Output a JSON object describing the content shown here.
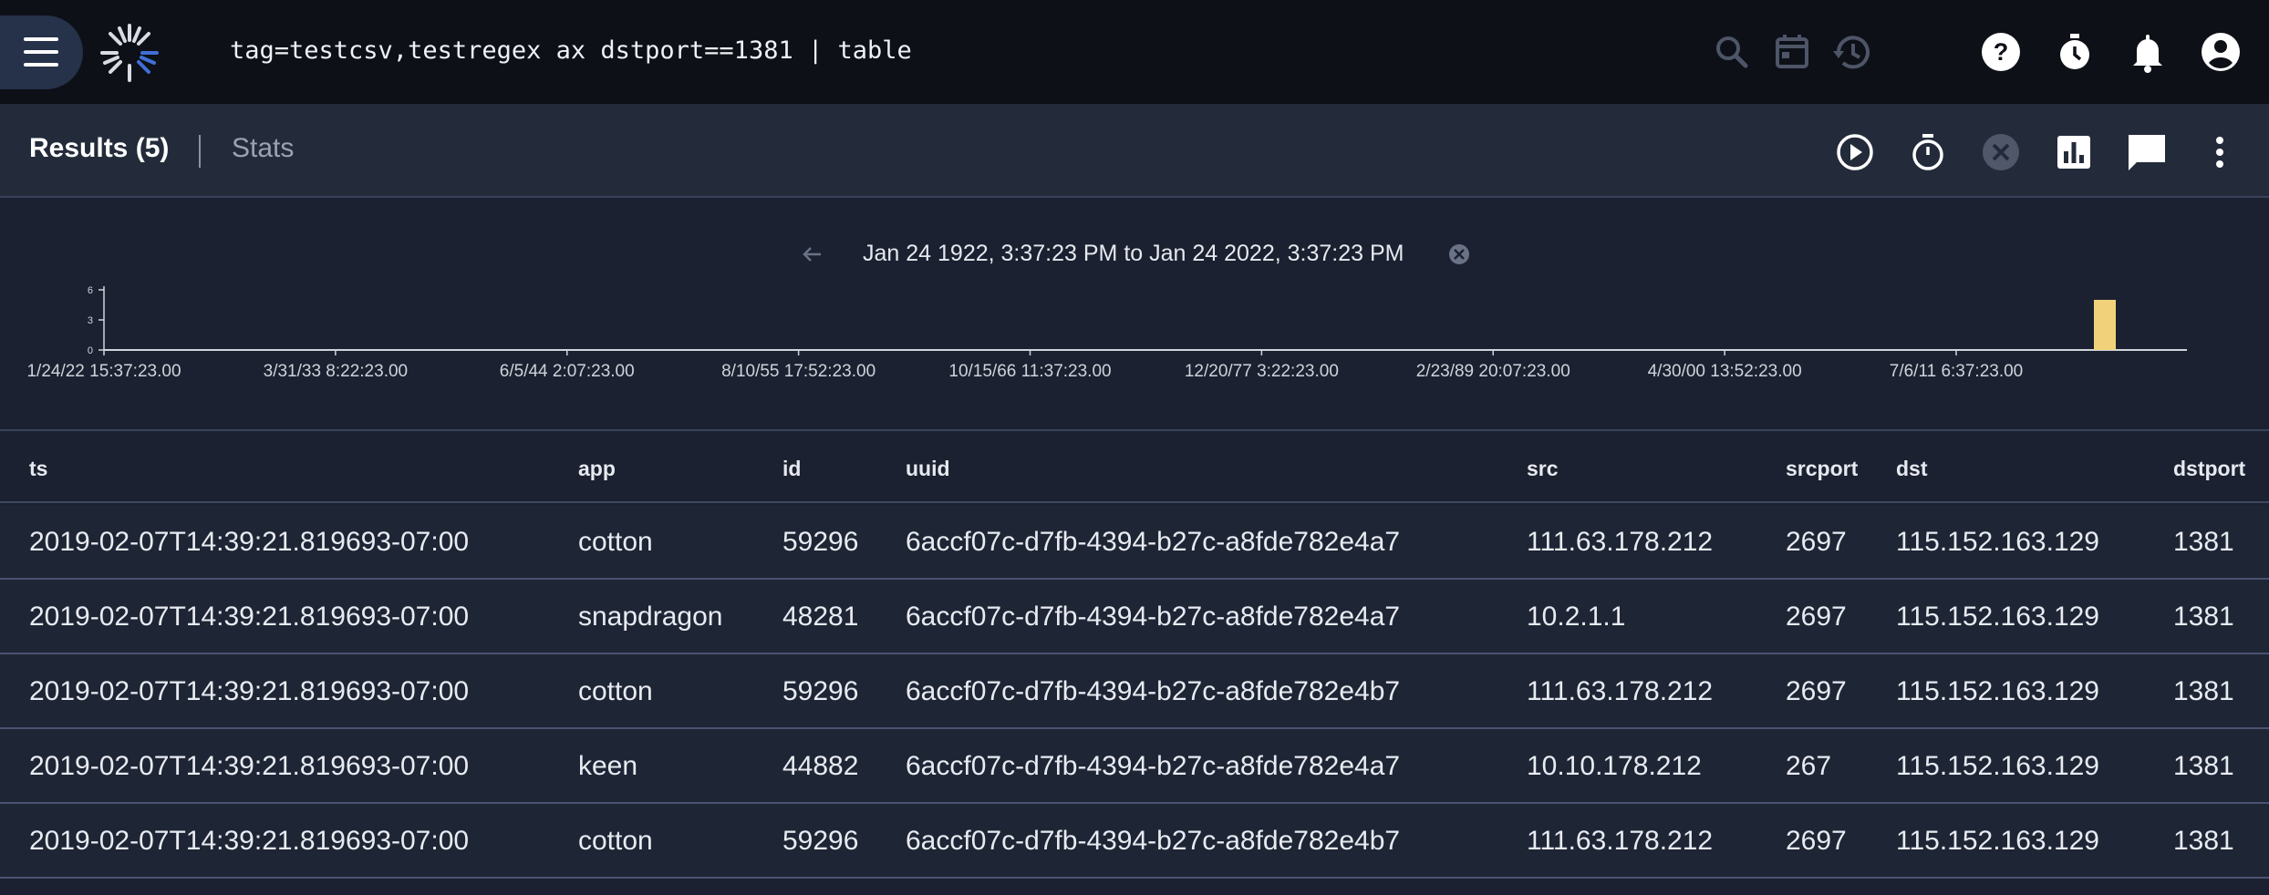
{
  "topbar": {
    "query": "tag=testcsv,testregex ax dstport==1381 | table",
    "icons": [
      "menu-icon",
      "gravwell-logo",
      "search-icon",
      "calendar-icon",
      "history-icon",
      "help-icon",
      "timer-icon",
      "bell-icon",
      "account-icon"
    ]
  },
  "tabs": {
    "results_label": "Results (5)",
    "stats_label": "Stats"
  },
  "toolbar_icons": [
    "play-icon",
    "stopwatch-icon",
    "cancel-icon",
    "chart-icon",
    "comment-icon",
    "more-vert-icon"
  ],
  "histogram": {
    "range_label": "Jan 24 1922, 3:37:23 PM to Jan 24 2022, 3:37:23 PM",
    "y_ticks": [
      "6",
      "3",
      "0"
    ],
    "x_ticks": [
      "1/24/22 15:37:23.00",
      "3/31/33 8:22:23.00",
      "6/5/44 2:07:23.00",
      "8/10/55 17:52:23.00",
      "10/15/66 11:37:23.00",
      "12/20/77 3:22:23.00",
      "2/23/89 20:07:23.00",
      "4/30/00 13:52:23.00",
      "7/6/11 6:37:23.00"
    ],
    "bar_color": "#f1d27a"
  },
  "chart_data": {
    "type": "bar",
    "title": "",
    "xlabel": "",
    "ylabel": "",
    "ylim": [
      0,
      6
    ],
    "x_ticks": [
      "1/24/22 15:37:23.00",
      "3/31/33 8:22:23.00",
      "6/5/44 2:07:23.00",
      "8/10/55 17:52:23.00",
      "10/15/66 11:37:23.00",
      "12/20/77 3:22:23.00",
      "2/23/89 20:07:23.00",
      "4/30/00 13:52:23.00",
      "7/6/11 6:37:23.00"
    ],
    "bars": [
      {
        "x": "2019-02-07",
        "value": 5
      }
    ]
  },
  "table": {
    "columns": [
      "ts",
      "app",
      "id",
      "uuid",
      "src",
      "srcport",
      "dst",
      "dstport"
    ],
    "rows": [
      [
        "2019-02-07T14:39:21.819693-07:00",
        "cotton",
        "59296",
        "6accf07c-d7fb-4394-b27c-a8fde782e4a7",
        "111.63.178.212",
        "2697",
        "115.152.163.129",
        "1381"
      ],
      [
        "2019-02-07T14:39:21.819693-07:00",
        "snapdragon",
        "48281",
        "6accf07c-d7fb-4394-b27c-a8fde782e4a7",
        "10.2.1.1",
        "2697",
        "115.152.163.129",
        "1381"
      ],
      [
        "2019-02-07T14:39:21.819693-07:00",
        "cotton",
        "59296",
        "6accf07c-d7fb-4394-b27c-a8fde782e4b7",
        "111.63.178.212",
        "2697",
        "115.152.163.129",
        "1381"
      ],
      [
        "2019-02-07T14:39:21.819693-07:00",
        "keen",
        "44882",
        "6accf07c-d7fb-4394-b27c-a8fde782e4a7",
        "10.10.178.212",
        "267",
        "115.152.163.129",
        "1381"
      ],
      [
        "2019-02-07T14:39:21.819693-07:00",
        "cotton",
        "59296",
        "6accf07c-d7fb-4394-b27c-a8fde782e4b7",
        "111.63.178.212",
        "2697",
        "115.152.163.129",
        "1381"
      ]
    ]
  }
}
